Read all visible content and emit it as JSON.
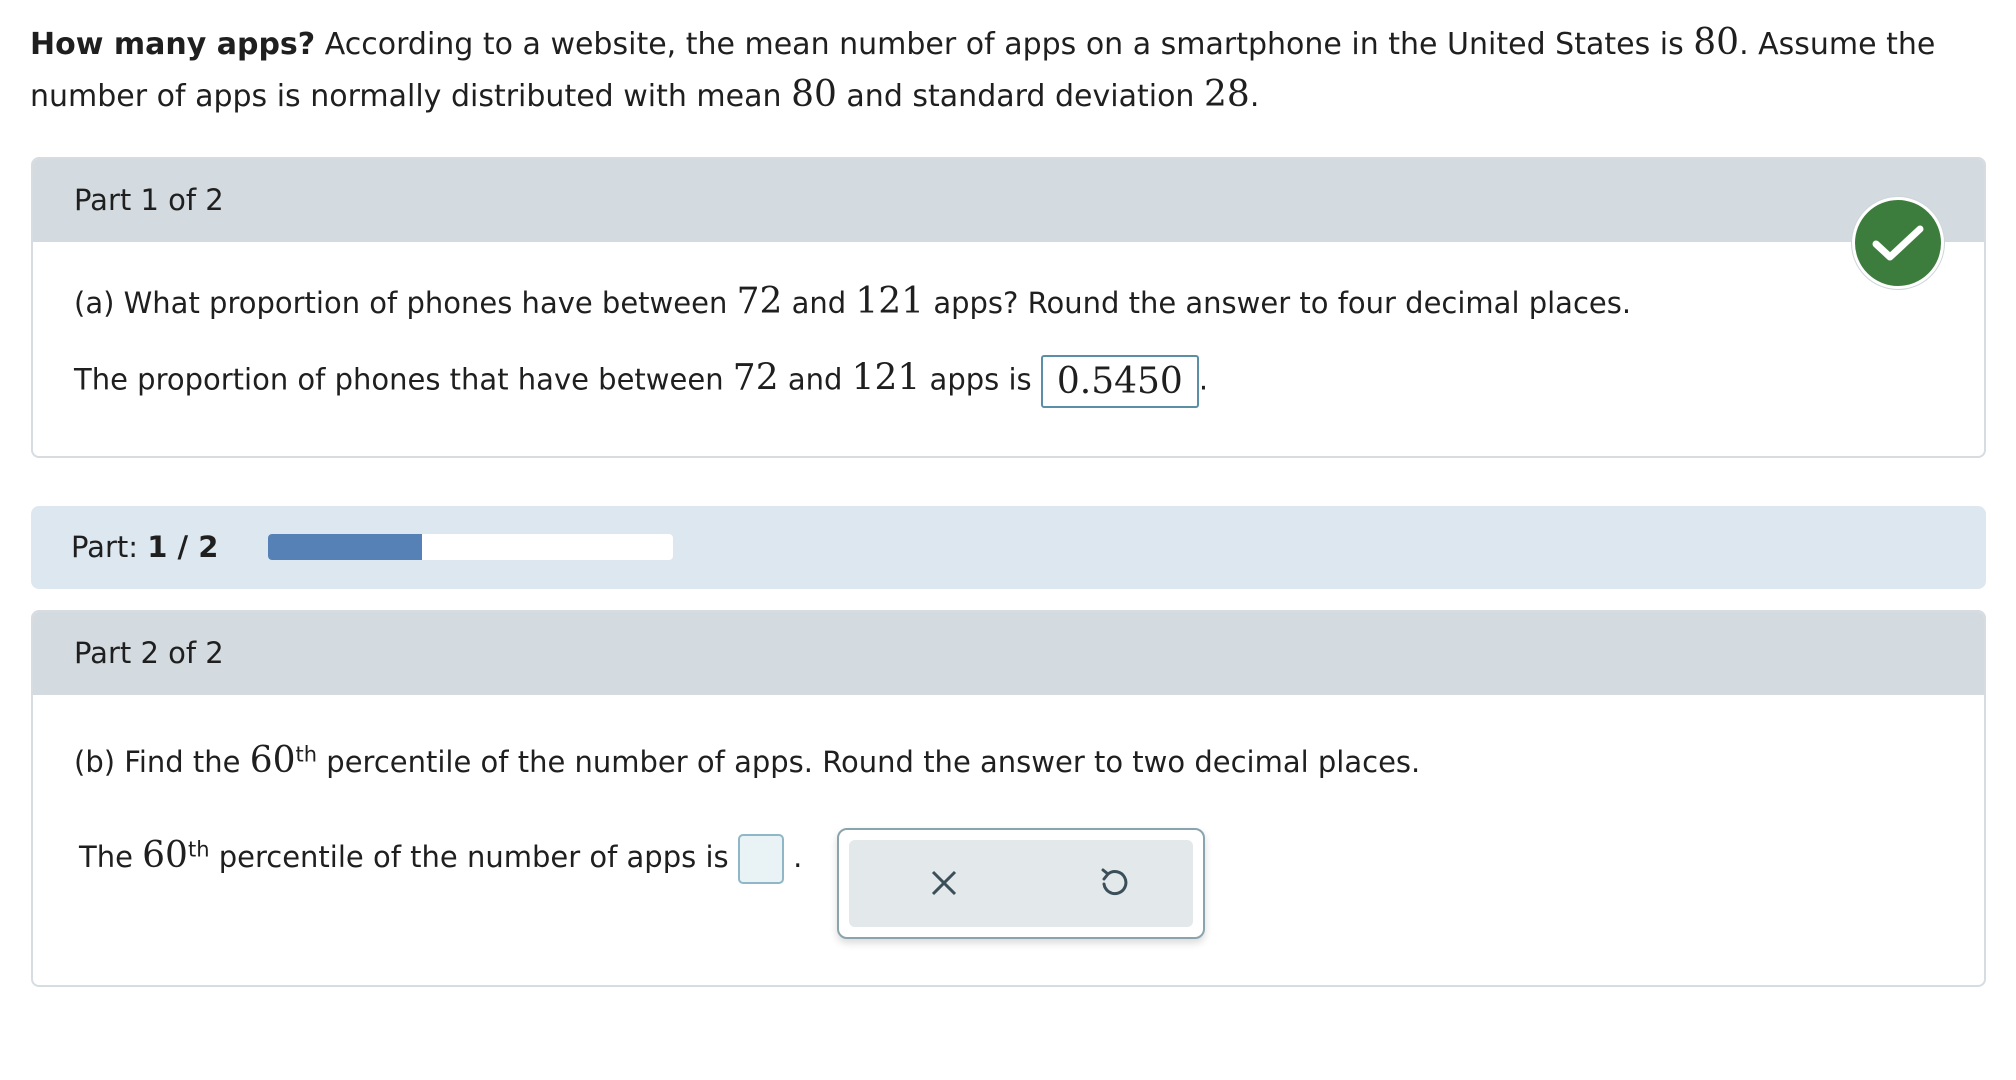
{
  "problem": {
    "title": "How many apps?",
    "s1": "According to a website, the mean number of apps on a smartphone in the United States is",
    "mean_val": "80",
    "s2": ". Assume the number of apps is normally distributed with mean",
    "mean_val2": "80",
    "s3": "and standard deviation",
    "sd_val": "28",
    "s4": "."
  },
  "part1": {
    "header": "Part 1 of 2",
    "q_a": "(a) What proportion of phones have between",
    "q_lo": "72",
    "q_and": "and",
    "q_hi": "121",
    "q_b": "apps? Round the answer to four decimal places.",
    "ans_a": "The proportion of phones that have between",
    "ans_lo": "72",
    "ans_and": "and",
    "ans_hi": "121",
    "ans_b": "apps is",
    "answer": "0.5450",
    "period": "."
  },
  "progress": {
    "label": "Part:",
    "value": "1 / 2",
    "fraction": 0.38
  },
  "part2": {
    "header": "Part 2 of 2",
    "q_a": "(b) Find the",
    "q_num": "60",
    "q_sup": "th",
    "q_b": "percentile of the number of apps. Round the answer to two decimal places.",
    "ans_a": "The",
    "ans_num": "60",
    "ans_sup": "th",
    "ans_b": "percentile of the number of apps is",
    "period": "."
  },
  "colors": {
    "accent_green": "#3c7d3e",
    "progress_blue": "#5581b7",
    "header_gray": "#d3dbe0"
  },
  "icons": {
    "check": "checkmark-icon",
    "clear": "close-icon",
    "undo": "undo-icon"
  }
}
